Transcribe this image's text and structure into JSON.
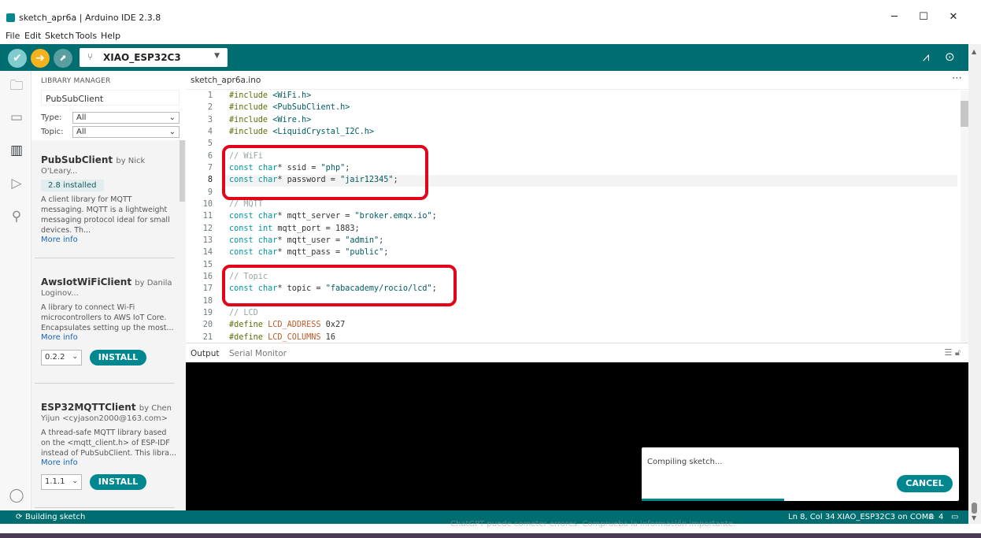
{
  "window": {
    "title": "sketch_apr6a | Arduino IDE 2.3.8"
  },
  "menu": [
    "File",
    "Edit",
    "Sketch",
    "Tools",
    "Help"
  ],
  "toolbar": {
    "board": "XIAO_ESP32C3"
  },
  "library_manager": {
    "header": "LIBRARY MANAGER",
    "search_value": "PubSubClient",
    "type_label": "Type:",
    "type_value": "All",
    "topic_label": "Topic:",
    "topic_value": "All",
    "items": [
      {
        "name": "PubSubClient",
        "by": "by Nick",
        "author": "O'Leary...",
        "installed": "2.8 installed",
        "description": "A client library for MQTT messaging. MQTT is a lightweight messaging protocol ideal for small devices. Th...",
        "more": "More info"
      },
      {
        "name": "AwsIotWiFiClient",
        "by": "by Danila",
        "author": "Loginov...",
        "description": "A library to connect Wi-Fi microcontrollers to AWS IoT Core. Encapsulates setting up the most...",
        "more": "More info",
        "version": "0.2.2",
        "install": "INSTALL"
      },
      {
        "name": "ESP32MQTTClient",
        "by": "by Chen",
        "author": "Yijun <cyjason2000@163.com>",
        "description": "A thread-safe MQTT library based on the <mqtt_client.h> of ESP-IDF instead of PubSubClient. This libra...",
        "more": "More info",
        "version": "1.1.1",
        "install": "INSTALL"
      }
    ]
  },
  "editor": {
    "tab": "sketch_apr6a.ino",
    "line_numbers": [
      "1",
      "2",
      "3",
      "4",
      "5",
      "6",
      "7",
      "8",
      "9",
      "10",
      "11",
      "12",
      "13",
      "14",
      "15",
      "16",
      "17",
      "18",
      "19",
      "20",
      "21"
    ],
    "lines": {
      "l1_a": "#include",
      "l1_b": " <WiFi.h>",
      "l2_a": "#include",
      "l2_b": " <PubSubClient.h>",
      "l3_a": "#include",
      "l3_b": " <Wire.h>",
      "l4_a": "#include",
      "l4_b": " <LiquidCrystal_I2C.h>",
      "l6": "// WiFi",
      "l7_a": "const",
      "l7_b": " char",
      "l7_c": "* ssid = ",
      "l7_d": "\"php\"",
      "l7_e": ";",
      "l8_a": "const",
      "l8_b": " char",
      "l8_c": "* password = ",
      "l8_d": "\"jair12345\"",
      "l8_e": ";",
      "l10": "// MQTT",
      "l11_a": "const",
      "l11_b": " char",
      "l11_c": "* mqtt_server = ",
      "l11_d": "\"broker.emqx.io\"",
      "l11_e": ";",
      "l12_a": "const",
      "l12_b": " int",
      "l12_c": " mqtt_port = 1883;",
      "l13_a": "const",
      "l13_b": " char",
      "l13_c": "* mqtt_user = ",
      "l13_d": "\"admin\"",
      "l13_e": ";",
      "l14_a": "const",
      "l14_b": " char",
      "l14_c": "* mqtt_pass = ",
      "l14_d": "\"public\"",
      "l14_e": ";",
      "l16": "// Topic",
      "l17_a": "const",
      "l17_b": " char",
      "l17_c": "* topic = ",
      "l17_d": "\"fabacademy/rocio/lcd\"",
      "l17_e": ";",
      "l19": "// LCD",
      "l20_a": "#define",
      "l20_b": " LCD_ADDRESS",
      "l20_c": " 0x27",
      "l21_a": "#define",
      "l21_b": " LCD_COLUMNS",
      "l21_c": " 16"
    }
  },
  "output": {
    "tab_output": "Output",
    "tab_serial": "Serial Monitor"
  },
  "notification": {
    "message": "Compiling sketch...",
    "cancel": "CANCEL"
  },
  "status": {
    "building": "Building sketch",
    "cursor": "Ln 8, Col 34",
    "board_port": "XIAO_ESP32C3 on COM8",
    "notifications": "4"
  },
  "background_text": "ChatGPT puede cometer errores. Comprueba la información importante.",
  "colors": {
    "teal": "#006d70",
    "accent": "#00878f",
    "highlight_red": "#e3061b"
  }
}
